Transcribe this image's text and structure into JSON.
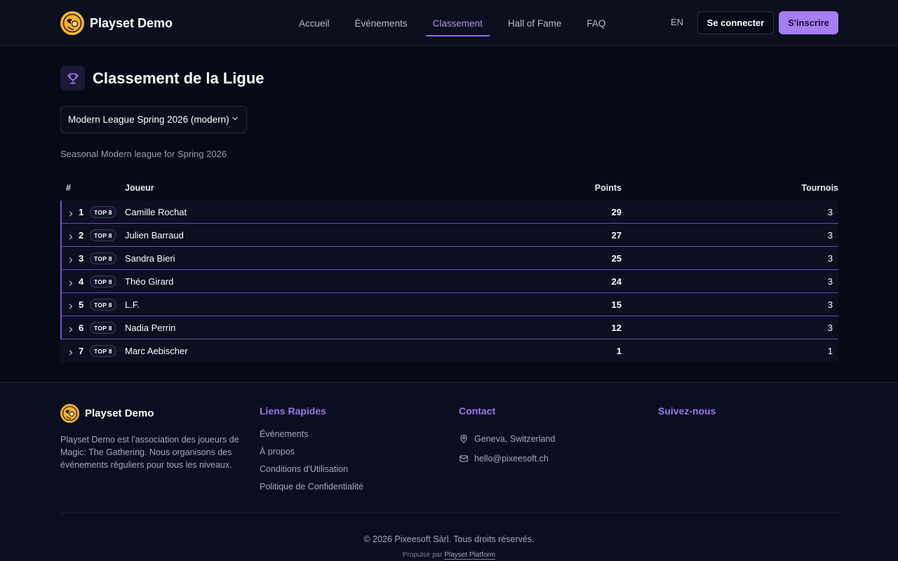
{
  "header": {
    "brand": "Playset Demo",
    "nav": [
      "Accueil",
      "Événements",
      "Classement",
      "Hall of Fame",
      "FAQ"
    ],
    "active_nav": "Classement",
    "lang": "EN",
    "login_label": "Se connecter",
    "signup_label": "S'inscrire"
  },
  "page": {
    "title": "Classement de la Ligue",
    "title_icon": "trophy-icon",
    "league_select": "Modern League Spring 2026 (modern)",
    "description": "Seasonal Modern league for Spring 2026"
  },
  "table": {
    "headers": {
      "rank": "#",
      "player": "Joueur",
      "points": "Points",
      "tournois": "Tournois"
    },
    "rows": [
      {
        "rank": "1",
        "badge": "TOP 8",
        "player": "Camille Rochat",
        "points": "29",
        "tournois": "3"
      },
      {
        "rank": "2",
        "badge": "TOP 8",
        "player": "Julien Barraud",
        "points": "27",
        "tournois": "3"
      },
      {
        "rank": "3",
        "badge": "TOP 8",
        "player": "Sandra Bieri",
        "points": "25",
        "tournois": "3"
      },
      {
        "rank": "4",
        "badge": "TOP 8",
        "player": "Théo Girard",
        "points": "24",
        "tournois": "3"
      },
      {
        "rank": "5",
        "badge": "TOP 8",
        "player": "L.F.",
        "points": "15",
        "tournois": "3"
      },
      {
        "rank": "6",
        "badge": "TOP 8",
        "player": "Nadia Perrin",
        "points": "12",
        "tournois": "3"
      },
      {
        "rank": "7",
        "badge": "TOP 8",
        "player": "Marc Aebischer",
        "points": "1",
        "tournois": "1"
      }
    ]
  },
  "footer": {
    "brand": "Playset Demo",
    "description": "Playset Demo est l'association des joueurs de Magic: The Gathering. Nous organisons des événements réguliers pour tous les niveaux.",
    "quick_links_title": "Liens Rapides",
    "quick_links": [
      "Événements",
      "À propos",
      "Conditions d'Utilisation",
      "Politique de Confidentialité"
    ],
    "contact_title": "Contact",
    "location": "Geneva, Switzerland",
    "email": "hello@pixeesoft.ch",
    "follow_title": "Suivez-nous",
    "copyright": "© 2026 Pixeesoft Sàrl. Tous droits réservés.",
    "powered_prefix": "Propulsé par",
    "powered_link": "Playset Platform"
  },
  "colors": {
    "background": "#060a17",
    "accent": "#a57ef2",
    "logo": "#f0b23a"
  }
}
